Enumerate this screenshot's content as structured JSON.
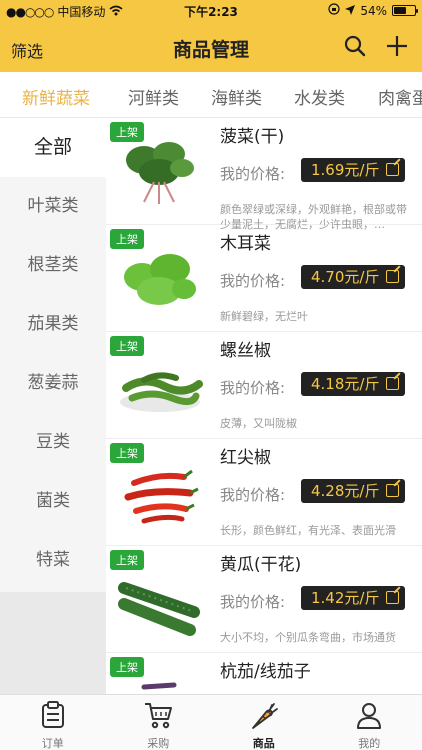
{
  "status": {
    "carrier": "中国移动",
    "time": "下午2:23",
    "battery": "54%"
  },
  "nav": {
    "filter": "筛选",
    "title": "商品管理",
    "search_icon": "search-icon",
    "add_icon": "plus-icon"
  },
  "tabs": [
    {
      "label": "新鲜蔬菜",
      "active": true
    },
    {
      "label": "河鲜类"
    },
    {
      "label": "海鲜类"
    },
    {
      "label": "水发类"
    },
    {
      "label": "肉禽蛋"
    }
  ],
  "sidebar": [
    {
      "label": "全部",
      "active": true
    },
    {
      "label": "叶菜类"
    },
    {
      "label": "根茎类"
    },
    {
      "label": "茄果类"
    },
    {
      "label": "葱姜蒜"
    },
    {
      "label": "豆类"
    },
    {
      "label": "菌类"
    },
    {
      "label": "特菜"
    }
  ],
  "price_label": "我的价格:",
  "products": [
    {
      "badge": "上架",
      "name": "菠菜(干)",
      "price": "1.69元/斤",
      "desc": "颜色翠绿或深绿，外观鲜艳，根部或带少量泥土，无腐烂，少许虫眼，…"
    },
    {
      "badge": "上架",
      "name": "木耳菜",
      "price": "4.70元/斤",
      "desc": "新鲜碧绿，无烂叶"
    },
    {
      "badge": "上架",
      "name": "螺丝椒",
      "price": "4.18元/斤",
      "desc": "皮薄，又叫陇椒"
    },
    {
      "badge": "上架",
      "name": "红尖椒",
      "price": "4.28元/斤",
      "desc": "长形，颜色鲜红，有光泽、表面光滑"
    },
    {
      "badge": "上架",
      "name": "黄瓜(干花)",
      "price": "1.42元/斤",
      "desc": "大小不均，个别瓜条弯曲，市场通货"
    },
    {
      "badge": "上架",
      "name": "杭茄/线茄子",
      "price": "",
      "desc": ""
    }
  ],
  "bottom_tabs": [
    {
      "label": "订单",
      "icon": "clipboard-icon"
    },
    {
      "label": "采购",
      "icon": "cart-icon"
    },
    {
      "label": "商品",
      "icon": "carrot-icon",
      "active": true
    },
    {
      "label": "我的",
      "icon": "user-icon"
    }
  ],
  "colors": {
    "brand": "#f6c743",
    "badge": "#2aa63a",
    "tab_active": "#e8b44a",
    "price_bg": "#222222"
  }
}
